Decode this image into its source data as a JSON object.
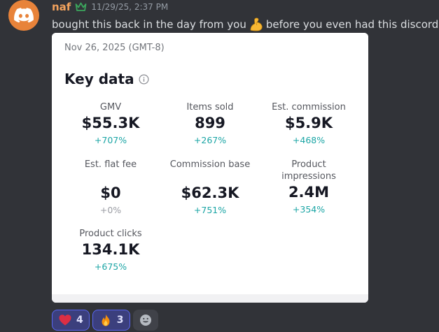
{
  "message": {
    "username": "naf",
    "timestamp": "11/29/25, 2:37 PM",
    "text_before": "bought this back in the day from you",
    "text_after": "before you even had this discord",
    "inline_emoji": "flexed-biceps"
  },
  "embed": {
    "date": "Nov 26, 2025 (GMT-8)",
    "title": "Key data",
    "metrics": [
      {
        "label": "GMV",
        "value": "$55.3K",
        "change": "+707%"
      },
      {
        "label": "Items sold",
        "value": "899",
        "change": "+267%"
      },
      {
        "label": "Est. commission",
        "value": "$5.9K",
        "change": "+468%"
      },
      {
        "label": "Est. flat fee",
        "value": "$0",
        "change": "+0%"
      },
      {
        "label": "Commission base",
        "value": "$62.3K",
        "change": "+751%"
      },
      {
        "label": "Product impressions",
        "value": "2.4M",
        "change": "+354%"
      },
      {
        "label": "Product clicks",
        "value": "134.1K",
        "change": "+675%"
      }
    ]
  },
  "reactions": [
    {
      "emoji": "red-heart",
      "count": "4"
    },
    {
      "emoji": "fire",
      "count": "3"
    }
  ],
  "colors": {
    "background": "#313338",
    "username": "#f2a25d",
    "positive_change": "#1ba5a5",
    "neutral_change": "#9a9ca3",
    "reaction_bg": "#3b3f7d",
    "reaction_border": "#5865f2"
  }
}
